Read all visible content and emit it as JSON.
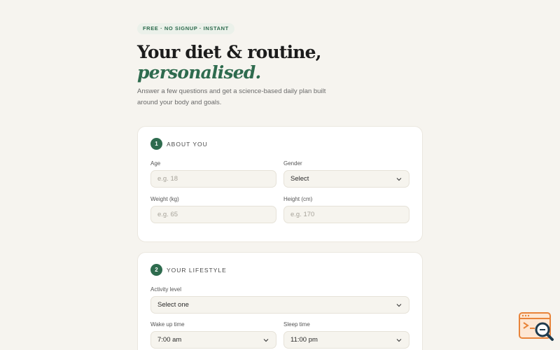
{
  "hero": {
    "pill": "FREE · NO SIGNUP · INSTANT",
    "title_line1": "Your diet & routine,",
    "title_line2": "personalised.",
    "subtitle": "Answer a few questions and get a science-based daily plan built around your body and goals."
  },
  "about": {
    "number": "1",
    "title": "ABOUT YOU",
    "age": {
      "label": "Age",
      "placeholder": "e.g. 18"
    },
    "gender": {
      "label": "Gender",
      "value": "Select"
    },
    "weight": {
      "label": "Weight (kg)",
      "placeholder": "e.g. 65"
    },
    "height": {
      "label": "Height (cm)",
      "placeholder": "e.g. 170"
    }
  },
  "lifestyle": {
    "number": "2",
    "title": "YOUR LIFESTYLE",
    "activity": {
      "label": "Activity level",
      "value": "Select one"
    },
    "wake": {
      "label": "Wake up time",
      "value": "7:00 am"
    },
    "sleep": {
      "label": "Sleep time",
      "value": "11:00 pm"
    }
  },
  "colors": {
    "accent": "#2e6b4e",
    "background": "#f6f4ef"
  }
}
